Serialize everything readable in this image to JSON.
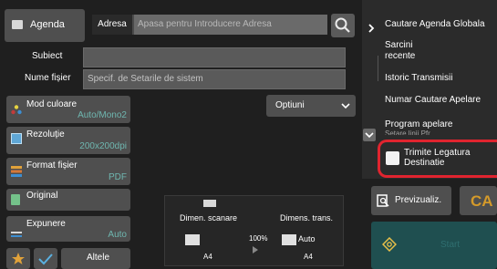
{
  "header": {
    "agenda_label": "Agenda",
    "address_tab": "Adresa",
    "address_placeholder": "Apasa pentru Introducere Adresa"
  },
  "form": {
    "subject_label": "Subiect",
    "filename_label": "Nume fișier",
    "filename_placeholder": "Specif. de Setarile de sistem"
  },
  "settings": [
    {
      "label": "Mod culoare",
      "value": "Auto/Mono2"
    },
    {
      "label": "Rezoluție",
      "value": "200x200dpi"
    },
    {
      "label": "Format fișier",
      "value": "PDF"
    },
    {
      "label": "Original",
      "value": ""
    },
    {
      "label": "Expunere",
      "value": "Auto"
    }
  ],
  "options_label": "Optiuni",
  "bottom": {
    "other_label": "Altele"
  },
  "scan_panel": {
    "scan_size_label": "Dimen. scanare",
    "send_size_label": "Dimens. trans.",
    "ratio": "100%",
    "send_size_value": "Auto",
    "scan_paper": "A4",
    "send_paper": "A4"
  },
  "right_menu": [
    "Cautare Agenda Globala",
    "Sarcini recente",
    "Istoric Transmisii",
    "Numar Cautare Apelare",
    "Program apelare"
  ],
  "right_menu_cut": "Setare linii Pfr...",
  "checkbox_label": "Trimite Legatura Destinatie",
  "preview_label": "Previzualiz.",
  "ca_label": "CA",
  "start_label": "Start",
  "colors": {
    "accent": "#6fb7b0",
    "highlight": "#e0242f",
    "ca": "#d49a2a"
  }
}
